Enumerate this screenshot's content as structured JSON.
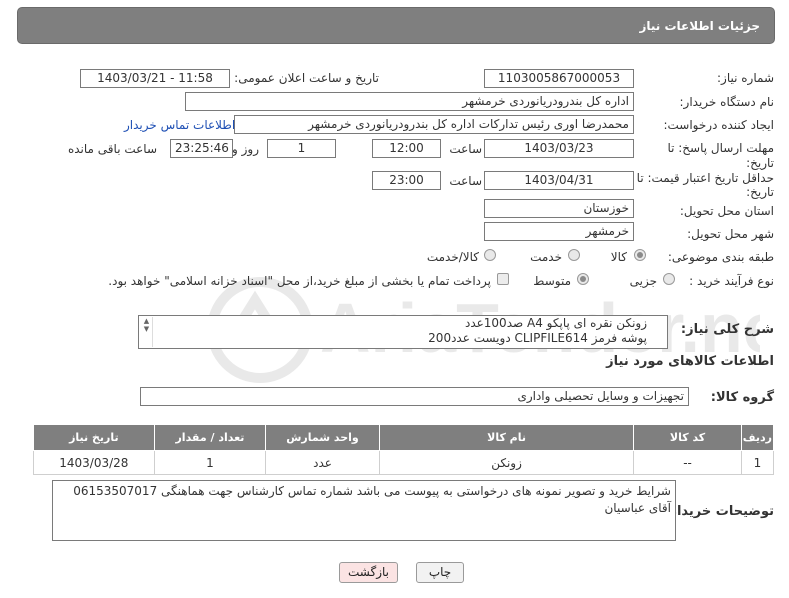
{
  "header": {
    "title": "جزئیات اطلاعات نیاز"
  },
  "fields": {
    "need_number_label": "شماره نیاز:",
    "need_number": "1103005867000053",
    "announce_label": "تاریخ و ساعت اعلان عمومی:",
    "announce_value": "1403/03/21 - 11:58",
    "buyer_org_label": "نام دستگاه خریدار:",
    "buyer_org": "اداره کل بندرودریانوردی خرمشهر",
    "creator_label": "ایجاد کننده درخواست:",
    "creator": "محمدرضا اوری رئیس تداركات اداره کل بندرودریانوردی خرمشهر",
    "buyer_contact_link": "اطلاعات تماس خریدار",
    "reply_deadline_label1": "مهلت ارسال پاسخ: تا",
    "reply_deadline_label2": "تاریخ:",
    "reply_date": "1403/03/23",
    "time_label": "ساعت",
    "reply_time": "12:00",
    "days_value": "1",
    "days_label": "روز و",
    "remaining_time": "23:25:46",
    "remaining_label": "ساعت باقی مانده",
    "price_validity_label1": "حداقل تاریخ اعتبار قیمت: تا",
    "price_validity_label2": "تاریخ:",
    "price_date": "1403/04/31",
    "price_time": "23:00",
    "province_label": "استان محل تحویل:",
    "province": "خوزستان",
    "city_label": "شهر محل تحویل:",
    "city": "خرمشهر",
    "category_label": "طبقه بندی موضوعی:",
    "category_options": [
      "کالا",
      "خدمت",
      "کالا/خدمت"
    ],
    "process_label": "نوع فرآیند خرید :",
    "process_options": [
      "جزیی",
      "متوسط"
    ],
    "payment_note": "پرداخت تمام یا بخشی از مبلغ خرید،از محل \"اسناد خزانه اسلامی\" خواهد بود."
  },
  "description": {
    "label": "شرح کلی نیاز:",
    "line1": "زونکن نقره ای پاپکو A4      صد100عدد",
    "line2": "پوشه فرمز CLIPFILE614    دویست عدد200"
  },
  "goods_info_title": "اطلاعات کالاهای مورد نیاز",
  "goods_group": {
    "label": "گروه کالا:",
    "value": "تجهیزات و وسایل تحصیلی واداری"
  },
  "table": {
    "headers": [
      "ردیف",
      "کد کالا",
      "نام کالا",
      "واحد شمارش",
      "تعداد / مقدار",
      "تاریخ نیاز"
    ],
    "rows": [
      [
        "1",
        "--",
        "زونکن",
        "عدد",
        "1",
        "1403/03/28"
      ]
    ]
  },
  "buyer_notes": {
    "label": "توضیحات خریدار:",
    "text": "شرایط خرید و تصویر نمونه های درخواستی به پیوست می باشد شماره تماس کارشناس جهت هماهنگی 06153507017 آقای عباسیان"
  },
  "buttons": {
    "print": "چاپ",
    "back": "بازگشت"
  },
  "watermark": "AriaTender.net",
  "colors": {
    "header_bg": "#7f7f7f",
    "link": "#1e4fb4",
    "back_btn_bg": "#fbe3e3"
  }
}
